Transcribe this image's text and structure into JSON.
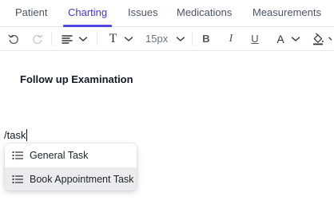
{
  "tabs": [
    {
      "label": "Patient"
    },
    {
      "label": "Charting"
    },
    {
      "label": "Issues"
    },
    {
      "label": "Medications"
    },
    {
      "label": "Measurements"
    }
  ],
  "active_tab": "Charting",
  "toolbar": {
    "font_size": "15px",
    "bold": "B",
    "italic": "I",
    "underline": "U",
    "text_color": "A",
    "text_style": "T"
  },
  "editor": {
    "heading": "Follow up Examination",
    "command_text": "/task"
  },
  "command_menu": {
    "items": [
      {
        "label": "General Task"
      },
      {
        "label": "Book Appointment Task"
      }
    ],
    "highlighted_index": 1
  },
  "colors": {
    "accent": "#4f46e5",
    "menu_highlight": "#ececef"
  }
}
